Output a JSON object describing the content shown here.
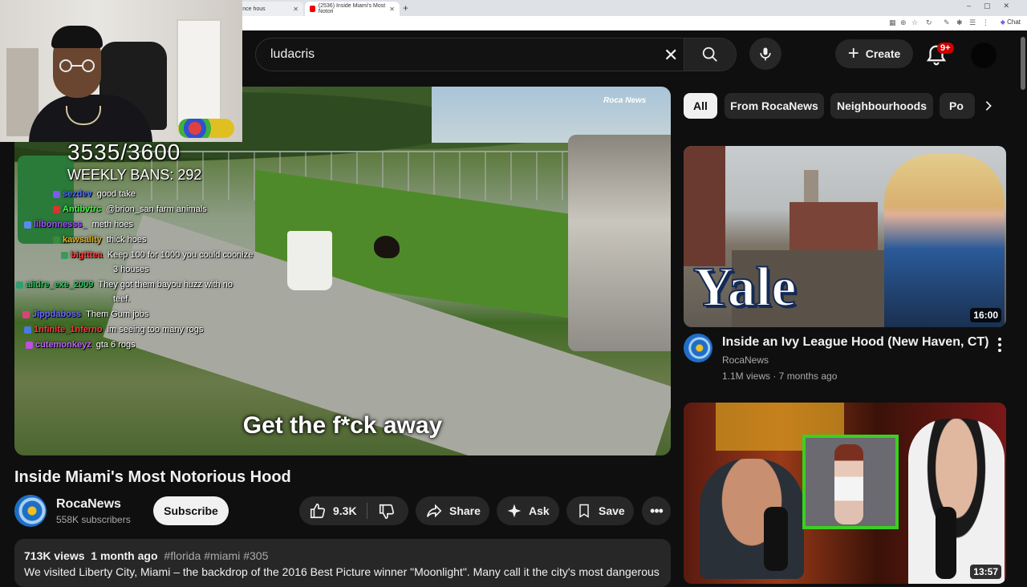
{
  "browser": {
    "tabs": [
      {
        "title": "tl turns off bounce hous"
      },
      {
        "title": "(2536) Inside Miami's Most Notori"
      }
    ],
    "chat_label": "Chat"
  },
  "header": {
    "search_value": "ludacris",
    "create_label": "Create",
    "notification_badge": "9+"
  },
  "stream_overlay": {
    "counter": "3535/3600",
    "weekly_bans": "WEEKLY BANS: 292",
    "chat": [
      {
        "user": "sezdev",
        "color": "#4a6cff",
        "msg": "good take"
      },
      {
        "user": "Antibvtrc",
        "color": "#3aff3a",
        "msg": "@brion_san farm animals"
      },
      {
        "user": "lilbonnesss_",
        "color": "#a050ff",
        "msg": "meth hoes"
      },
      {
        "user": "kawsality",
        "color": "#e0b020",
        "msg": "thick hoes"
      },
      {
        "user": "bigtttea",
        "color": "#ff3a3a",
        "msg": "Keep 100 for 1000 you could coonize"
      },
      {
        "user": "",
        "color": "#ffffff",
        "msg": "3 houses"
      },
      {
        "user": "aiidre_exe_2009",
        "color": "#30c060",
        "msg": "They got them bayou huzz with no"
      },
      {
        "user": "",
        "color": "#ffffff",
        "msg": "teef."
      },
      {
        "user": "Jippdaboss",
        "color": "#6a6aff",
        "msg": "Them Gum jobs"
      },
      {
        "user": "1nfinite_1nferno",
        "color": "#ff3a3a",
        "msg": "im seeing too many rogs"
      },
      {
        "user": "cutemonkeyz",
        "color": "#c060ff",
        "msg": "gta 6 rogs"
      }
    ]
  },
  "video": {
    "caption": "Get the f*ck away",
    "logo": "Roca News",
    "title": "Inside Miami's Most Notorious Hood",
    "channel": "RocaNews",
    "subscribers": "558K subscribers",
    "subscribe_label": "Subscribe",
    "likes": "9.3K",
    "share_label": "Share",
    "ask_label": "Ask",
    "save_label": "Save",
    "views": "713K views",
    "age": "1 month ago",
    "tags": "#florida #miami #305",
    "description": "We visited Liberty City, Miami – the backdrop of the 2016 Best Picture winner \"Moonlight\". Many call it the city's most dangerous"
  },
  "filters": {
    "chips": [
      "All",
      "From RocaNews",
      "Neighbourhoods",
      "Po"
    ]
  },
  "recommendations": [
    {
      "thumb_text": "Yale",
      "duration": "16:00",
      "title": "Inside an Ivy League Hood (New Haven, CT)",
      "channel": "RocaNews",
      "meta": "1.1M views · 7 months ago"
    },
    {
      "duration": "13:57"
    }
  ]
}
